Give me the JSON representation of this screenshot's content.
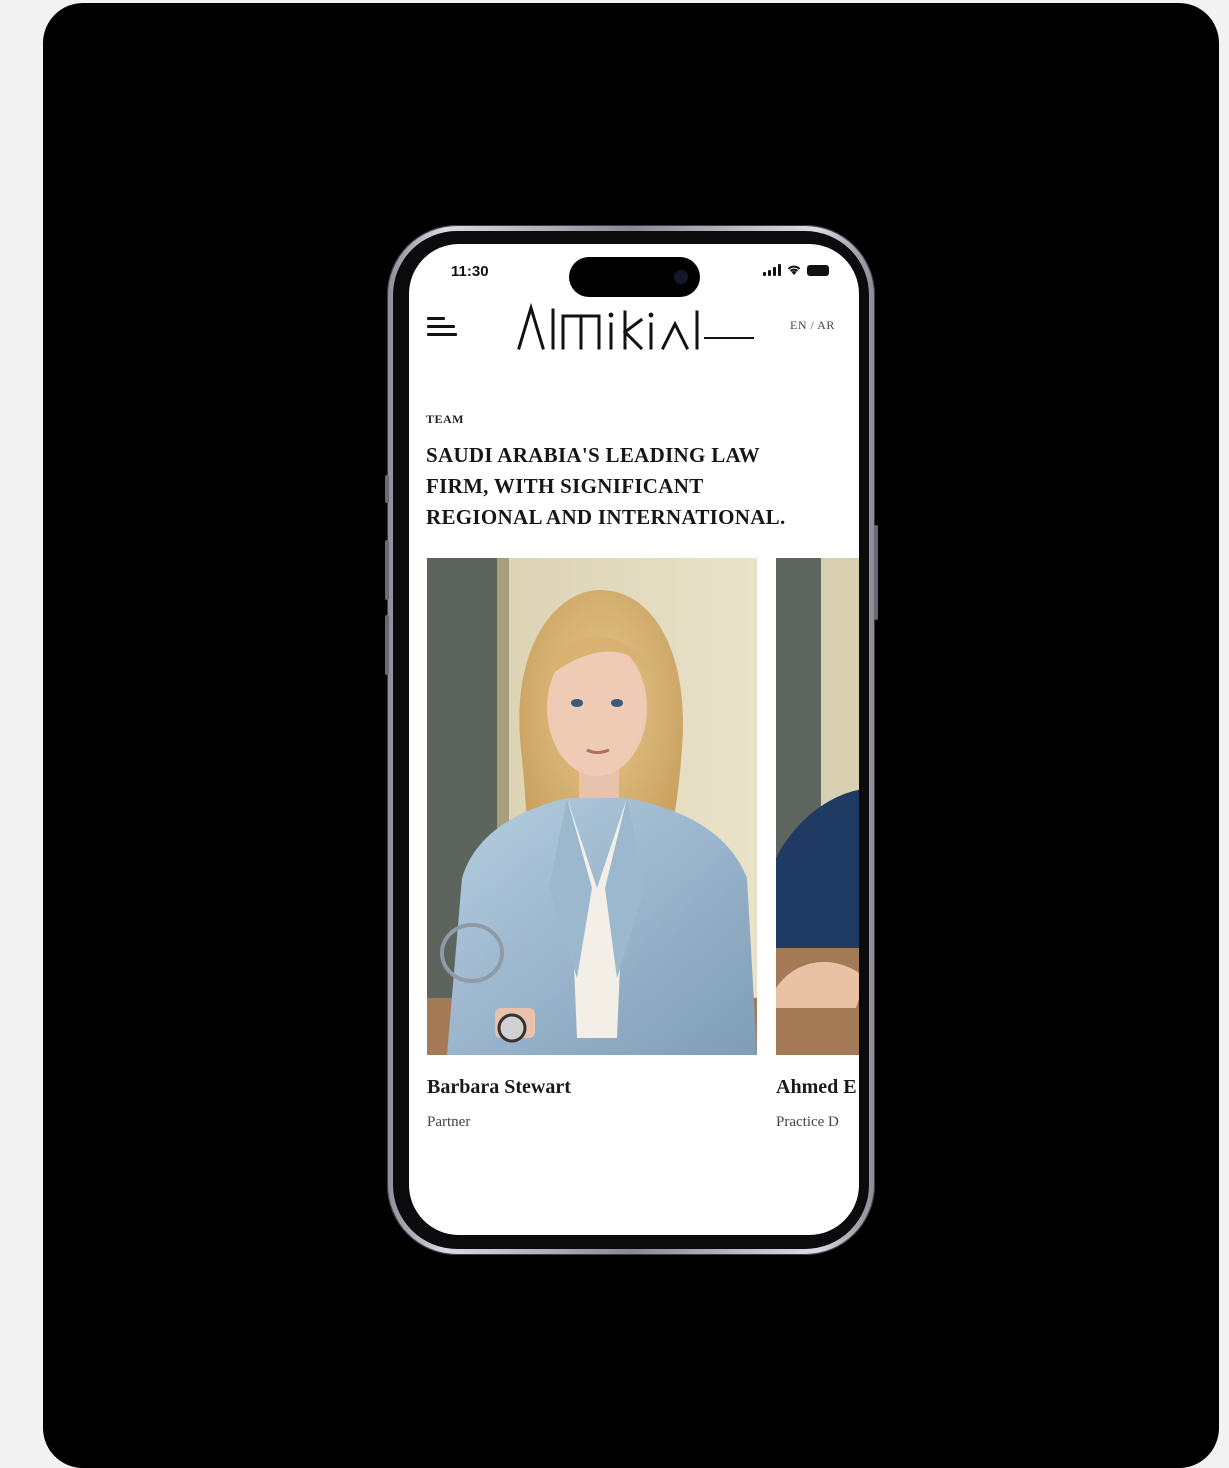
{
  "status_bar": {
    "time": "11:30"
  },
  "header": {
    "language_toggle": "EN / AR"
  },
  "team_section": {
    "eyebrow": "TEAM",
    "headline_lines": [
      "SAUDI ARABIA'S LEADING LAW",
      "FIRM, WITH SIGNIFICANT",
      "REGIONAL AND INTERNATIONAL."
    ],
    "members": [
      {
        "name": "Barbara Stewart",
        "role": "Partner"
      },
      {
        "name": "Ahmed E",
        "role": "Practice D"
      }
    ]
  },
  "icons": {
    "menu": "hamburger-menu-icon",
    "signal": "cellular-signal-icon",
    "wifi": "wifi-icon",
    "battery": "battery-icon"
  },
  "colors": {
    "frame_background": "#000000",
    "page_background": "#f2f2f2",
    "screen_background": "#ffffff",
    "text_primary": "#161616"
  }
}
